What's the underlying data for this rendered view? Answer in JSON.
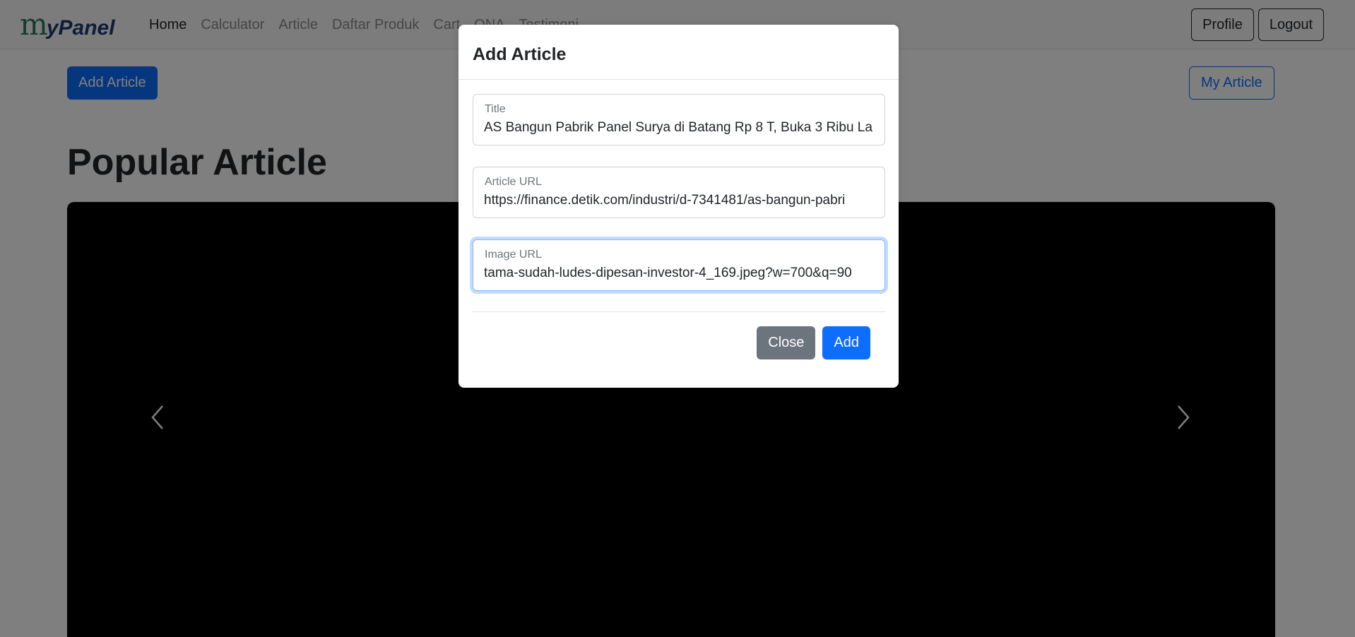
{
  "brand": {
    "initial": "m",
    "rest": "yPanel"
  },
  "nav": {
    "links": [
      "Home",
      "Calculator",
      "Article",
      "Daftar Produk",
      "Cart",
      "QNA",
      "Testimoni"
    ],
    "profile_label": "Profile",
    "logout_label": "Logout"
  },
  "page": {
    "add_article_label": "Add Article",
    "my_article_label": "My Article",
    "heading": "Popular Article"
  },
  "modal": {
    "title": "Add Article",
    "fields": [
      {
        "label": "Title",
        "value": "AS Bangun Pabrik Panel Surya di Batang Rp 8 T, Buka 3 Ribu La"
      },
      {
        "label": "Article URL",
        "value": "https://finance.detik.com/industri/d-7341481/as-bangun-pabri"
      },
      {
        "label": "Image URL",
        "value": "tama-sudah-ludes-dipesan-investor-4_169.jpeg?w=700&q=90"
      }
    ],
    "close_label": "Close",
    "add_label": "Add"
  },
  "colors": {
    "primary": "#0d6efd",
    "secondary": "#6c757d",
    "carousel_bg": "#000000"
  },
  "icons": {
    "prev": "chevron-left-icon",
    "next": "chevron-right-icon"
  }
}
